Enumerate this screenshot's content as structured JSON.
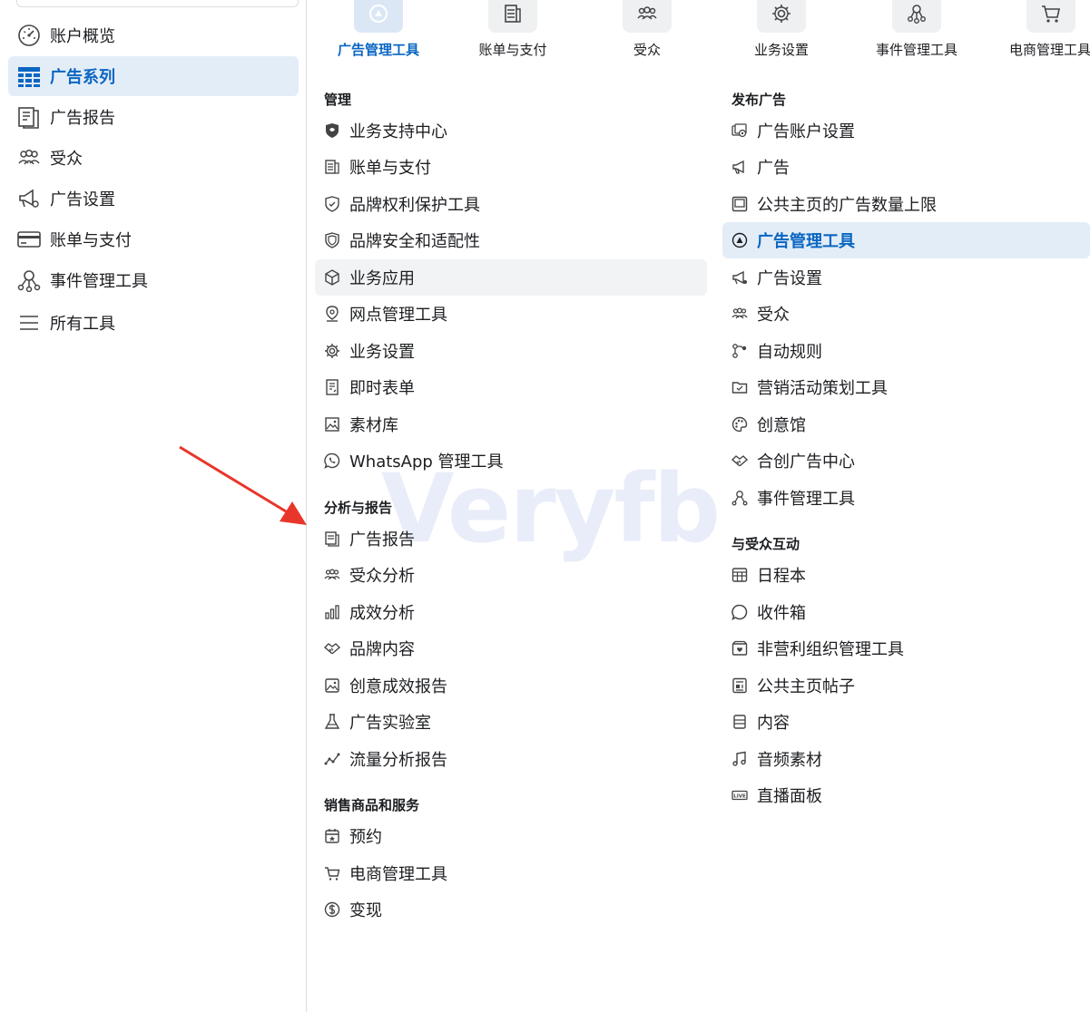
{
  "sidebar": {
    "items": [
      {
        "label": "账户概览",
        "icon": "gauge-icon"
      },
      {
        "label": "广告系列",
        "icon": "table-grid-icon",
        "active": true
      },
      {
        "label": "广告报告",
        "icon": "report-icon"
      },
      {
        "label": "受众",
        "icon": "people-icon"
      },
      {
        "label": "广告设置",
        "icon": "megaphone-gear-icon"
      },
      {
        "label": "账单与支付",
        "icon": "credit-card-icon"
      },
      {
        "label": "事件管理工具",
        "icon": "event-nodes-icon"
      },
      {
        "label": "所有工具",
        "icon": "menu-icon"
      }
    ]
  },
  "tabs": [
    {
      "label": "广告管理工具",
      "icon": "ads-manager-icon",
      "active": true
    },
    {
      "label": "账单与支付",
      "icon": "billing-icon"
    },
    {
      "label": "受众",
      "icon": "audience-icon"
    },
    {
      "label": "业务设置",
      "icon": "settings-gear-icon"
    },
    {
      "label": "事件管理工具",
      "icon": "event-manager-icon"
    },
    {
      "label": "电商管理工具",
      "icon": "cart-icon"
    }
  ],
  "left_sections": [
    {
      "title": "管理",
      "items": [
        {
          "label": "业务支持中心",
          "icon": "shield-heart-icon"
        },
        {
          "label": "账单与支付",
          "icon": "billing-stack-icon"
        },
        {
          "label": "品牌权利保护工具",
          "icon": "shield-check-icon"
        },
        {
          "label": "品牌安全和适配性",
          "icon": "shield-icon"
        },
        {
          "label": "业务应用",
          "icon": "cube-icon"
        },
        {
          "label": "网点管理工具",
          "icon": "location-pin-icon"
        },
        {
          "label": "业务设置",
          "icon": "gear-icon"
        },
        {
          "label": "即时表单",
          "icon": "form-icon"
        },
        {
          "label": "素材库",
          "icon": "image-library-icon"
        },
        {
          "label": "WhatsApp 管理工具",
          "icon": "whatsapp-icon"
        }
      ]
    },
    {
      "title": "分析与报告",
      "items": [
        {
          "label": "广告报告",
          "icon": "report-icon"
        },
        {
          "label": "受众分析",
          "icon": "people-icon"
        },
        {
          "label": "成效分析",
          "icon": "bar-chart-icon"
        },
        {
          "label": "品牌内容",
          "icon": "handshake-icon"
        },
        {
          "label": "创意成效报告",
          "icon": "image-icon"
        },
        {
          "label": "广告实验室",
          "icon": "flask-icon"
        },
        {
          "label": "流量分析报告",
          "icon": "line-trend-icon"
        }
      ]
    },
    {
      "title": "销售商品和服务",
      "items": [
        {
          "label": "预约",
          "icon": "calendar-star-icon"
        },
        {
          "label": "电商管理工具",
          "icon": "cart-icon"
        },
        {
          "label": "变现",
          "icon": "dollar-circle-icon"
        }
      ]
    }
  ],
  "right_sections": [
    {
      "title": "发布广告",
      "items": [
        {
          "label": "广告账户设置",
          "icon": "account-settings-icon"
        },
        {
          "label": "广告",
          "icon": "megaphone-icon"
        },
        {
          "label": "公共主页的广告数量上限",
          "icon": "page-limit-icon"
        },
        {
          "label": "广告管理工具",
          "icon": "ads-manager-icon",
          "active": true
        },
        {
          "label": "广告设置",
          "icon": "megaphone-gear-icon"
        },
        {
          "label": "受众",
          "icon": "people-icon"
        },
        {
          "label": "自动规则",
          "icon": "rules-icon"
        },
        {
          "label": "营销活动策划工具",
          "icon": "folder-check-icon"
        },
        {
          "label": "创意馆",
          "icon": "palette-icon"
        },
        {
          "label": "合创广告中心",
          "icon": "handshake-icon"
        },
        {
          "label": "事件管理工具",
          "icon": "event-nodes-icon"
        }
      ]
    },
    {
      "title": "与受众互动",
      "items": [
        {
          "label": "日程本",
          "icon": "calendar-grid-icon"
        },
        {
          "label": "收件箱",
          "icon": "chat-bubble-icon"
        },
        {
          "label": "非营利组织管理工具",
          "icon": "nonprofit-icon"
        },
        {
          "label": "公共主页帖子",
          "icon": "post-icon"
        },
        {
          "label": "内容",
          "icon": "content-icon"
        },
        {
          "label": "音频素材",
          "icon": "music-note-icon"
        },
        {
          "label": "直播面板",
          "icon": "live-icon"
        }
      ]
    }
  ],
  "watermark": "Veryfb",
  "colors": {
    "accent": "#0a66c2",
    "active_bg": "#e3edf7",
    "hover_bg": "#f2f3f5",
    "arrow": "#e8362b"
  }
}
